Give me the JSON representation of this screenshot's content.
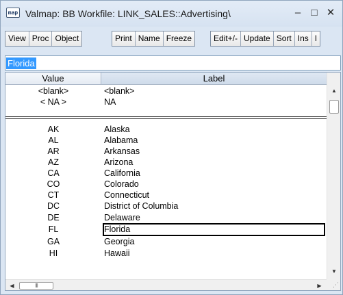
{
  "window": {
    "icon_label": "map",
    "title": "Valmap: BB   Workfile: LINK_SALES::Advertising\\",
    "minimize_glyph": "–",
    "maximize_glyph": "□",
    "close_glyph": "✕"
  },
  "toolbar": {
    "group1": [
      "View",
      "Proc",
      "Object"
    ],
    "group2": [
      "Print",
      "Name",
      "Freeze"
    ],
    "group3": [
      "Edit+/-",
      "Update",
      "Sort",
      "Ins",
      "I"
    ]
  },
  "edit": {
    "value": "Florida"
  },
  "grid": {
    "headers": {
      "value": "Value",
      "label": "Label"
    },
    "special_rows": [
      {
        "value": "<blank>",
        "label": "<blank>"
      },
      {
        "value": "< NA >",
        "label": "NA"
      }
    ],
    "rows": [
      {
        "value": "AK",
        "label": "Alaska"
      },
      {
        "value": "AL",
        "label": "Alabama"
      },
      {
        "value": "AR",
        "label": "Arkansas"
      },
      {
        "value": "AZ",
        "label": "Arizona"
      },
      {
        "value": "CA",
        "label": "California"
      },
      {
        "value": "CO",
        "label": "Colorado"
      },
      {
        "value": "CT",
        "label": "Connecticut"
      },
      {
        "value": "DC",
        "label": "District of Columbia"
      },
      {
        "value": "DE",
        "label": "Delaware"
      },
      {
        "value": "FL",
        "label": "Florida"
      },
      {
        "value": "GA",
        "label": "Georgia"
      },
      {
        "value": "HI",
        "label": "Hawaii"
      }
    ],
    "selected_row_index": 9,
    "hscroll_thumb_glyph": "III"
  }
}
